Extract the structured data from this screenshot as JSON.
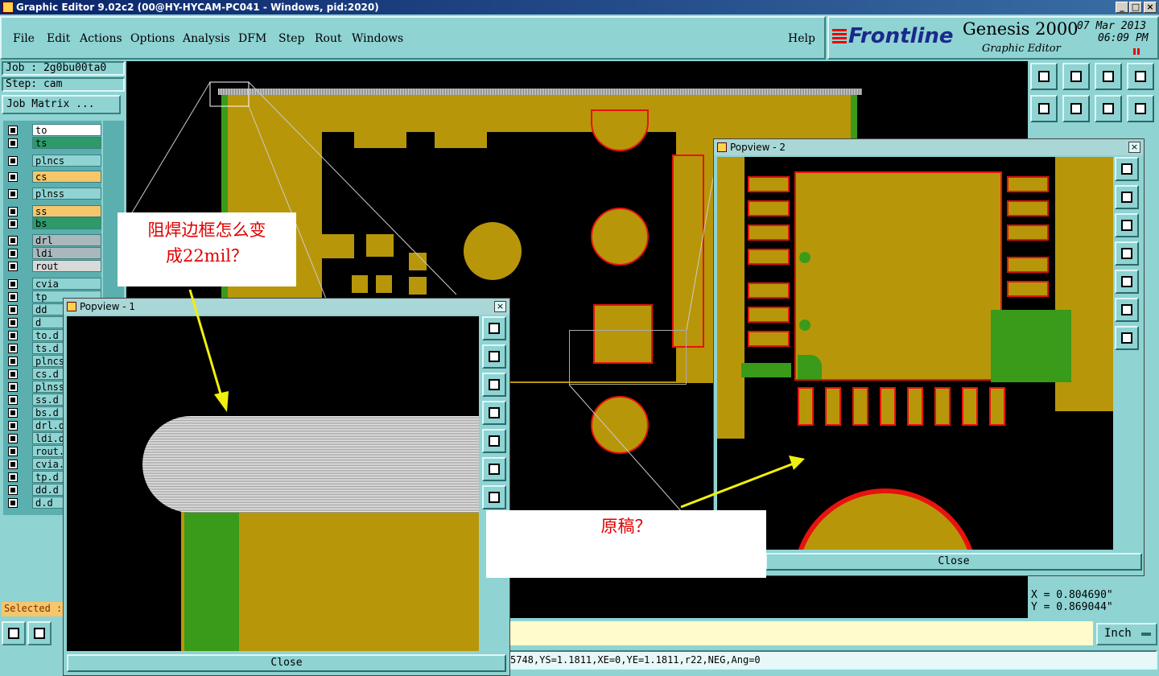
{
  "window": {
    "title": "Graphic Editor 9.02c2 (00@HY-HYCAM-PC041 - Windows, pid:2020)"
  },
  "menu": {
    "items": [
      "File",
      "Edit",
      "Actions",
      "Options",
      "Analysis",
      "DFM",
      "Step",
      "Rout",
      "Windows"
    ],
    "help": "Help"
  },
  "brand": {
    "logo": "Frontline",
    "product": "Genesis 2000",
    "subtitle": "Graphic Editor",
    "date": "07 Mar 2013",
    "time": "06:09 PM"
  },
  "job": {
    "job_label": "Job : 2g0bu00ta0",
    "step_label": "Step: cam",
    "matrix_button": "Job Matrix ..."
  },
  "layers": [
    "to",
    "ts",
    "plncs",
    "cs",
    "plnss",
    "ss",
    "bs",
    "drl",
    "ldi",
    "rout",
    "cvia",
    "tp",
    "dd",
    "d",
    "to.d",
    "ts.d",
    "plncs",
    "cs.d",
    "plnss",
    "ss.d",
    "bs.d",
    "drl.d",
    "ldi.d",
    "rout.",
    "cvia.",
    "tp.d",
    "dd.d",
    "d.d"
  ],
  "status": {
    "selected_label": "Selected :",
    "command_line": "5748,YS=1.1811,XE=0,YE=1.1811,r22,NEG,Ang=0",
    "x_readout": "X = 0.804690\"",
    "y_readout": "Y = 0.869044\"",
    "units": "Inch"
  },
  "popview1": {
    "title": "Popview - 1",
    "close_label": "Close"
  },
  "popview2": {
    "title": "Popview - 2",
    "close_label": "Close"
  },
  "annotations": {
    "question_line1": "阻焊边框怎么变",
    "question_line2": "成22mil？",
    "original": "原稿？"
  },
  "colors": {
    "background": "#8fd3d3",
    "copper": "#b8960a",
    "mask_outline": "#e8120e",
    "green": "#3a9a1a",
    "arrow": "#f0f010"
  }
}
